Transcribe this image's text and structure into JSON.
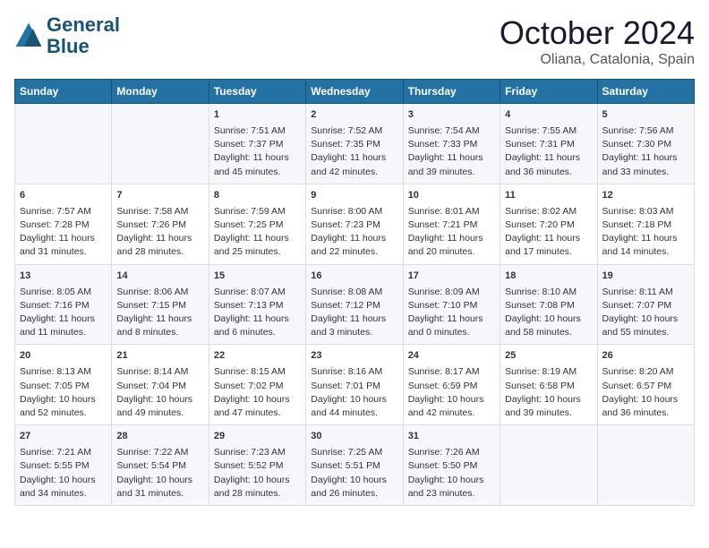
{
  "header": {
    "logo_line1": "General",
    "logo_line2": "Blue",
    "month": "October 2024",
    "location": "Oliana, Catalonia, Spain"
  },
  "columns": [
    "Sunday",
    "Monday",
    "Tuesday",
    "Wednesday",
    "Thursday",
    "Friday",
    "Saturday"
  ],
  "weeks": [
    [
      {
        "day": "",
        "lines": []
      },
      {
        "day": "",
        "lines": []
      },
      {
        "day": "1",
        "lines": [
          "Sunrise: 7:51 AM",
          "Sunset: 7:37 PM",
          "Daylight: 11 hours",
          "and 45 minutes."
        ]
      },
      {
        "day": "2",
        "lines": [
          "Sunrise: 7:52 AM",
          "Sunset: 7:35 PM",
          "Daylight: 11 hours",
          "and 42 minutes."
        ]
      },
      {
        "day": "3",
        "lines": [
          "Sunrise: 7:54 AM",
          "Sunset: 7:33 PM",
          "Daylight: 11 hours",
          "and 39 minutes."
        ]
      },
      {
        "day": "4",
        "lines": [
          "Sunrise: 7:55 AM",
          "Sunset: 7:31 PM",
          "Daylight: 11 hours",
          "and 36 minutes."
        ]
      },
      {
        "day": "5",
        "lines": [
          "Sunrise: 7:56 AM",
          "Sunset: 7:30 PM",
          "Daylight: 11 hours",
          "and 33 minutes."
        ]
      }
    ],
    [
      {
        "day": "6",
        "lines": [
          "Sunrise: 7:57 AM",
          "Sunset: 7:28 PM",
          "Daylight: 11 hours",
          "and 31 minutes."
        ]
      },
      {
        "day": "7",
        "lines": [
          "Sunrise: 7:58 AM",
          "Sunset: 7:26 PM",
          "Daylight: 11 hours",
          "and 28 minutes."
        ]
      },
      {
        "day": "8",
        "lines": [
          "Sunrise: 7:59 AM",
          "Sunset: 7:25 PM",
          "Daylight: 11 hours",
          "and 25 minutes."
        ]
      },
      {
        "day": "9",
        "lines": [
          "Sunrise: 8:00 AM",
          "Sunset: 7:23 PM",
          "Daylight: 11 hours",
          "and 22 minutes."
        ]
      },
      {
        "day": "10",
        "lines": [
          "Sunrise: 8:01 AM",
          "Sunset: 7:21 PM",
          "Daylight: 11 hours",
          "and 20 minutes."
        ]
      },
      {
        "day": "11",
        "lines": [
          "Sunrise: 8:02 AM",
          "Sunset: 7:20 PM",
          "Daylight: 11 hours",
          "and 17 minutes."
        ]
      },
      {
        "day": "12",
        "lines": [
          "Sunrise: 8:03 AM",
          "Sunset: 7:18 PM",
          "Daylight: 11 hours",
          "and 14 minutes."
        ]
      }
    ],
    [
      {
        "day": "13",
        "lines": [
          "Sunrise: 8:05 AM",
          "Sunset: 7:16 PM",
          "Daylight: 11 hours",
          "and 11 minutes."
        ]
      },
      {
        "day": "14",
        "lines": [
          "Sunrise: 8:06 AM",
          "Sunset: 7:15 PM",
          "Daylight: 11 hours",
          "and 8 minutes."
        ]
      },
      {
        "day": "15",
        "lines": [
          "Sunrise: 8:07 AM",
          "Sunset: 7:13 PM",
          "Daylight: 11 hours",
          "and 6 minutes."
        ]
      },
      {
        "day": "16",
        "lines": [
          "Sunrise: 8:08 AM",
          "Sunset: 7:12 PM",
          "Daylight: 11 hours",
          "and 3 minutes."
        ]
      },
      {
        "day": "17",
        "lines": [
          "Sunrise: 8:09 AM",
          "Sunset: 7:10 PM",
          "Daylight: 11 hours",
          "and 0 minutes."
        ]
      },
      {
        "day": "18",
        "lines": [
          "Sunrise: 8:10 AM",
          "Sunset: 7:08 PM",
          "Daylight: 10 hours",
          "and 58 minutes."
        ]
      },
      {
        "day": "19",
        "lines": [
          "Sunrise: 8:11 AM",
          "Sunset: 7:07 PM",
          "Daylight: 10 hours",
          "and 55 minutes."
        ]
      }
    ],
    [
      {
        "day": "20",
        "lines": [
          "Sunrise: 8:13 AM",
          "Sunset: 7:05 PM",
          "Daylight: 10 hours",
          "and 52 minutes."
        ]
      },
      {
        "day": "21",
        "lines": [
          "Sunrise: 8:14 AM",
          "Sunset: 7:04 PM",
          "Daylight: 10 hours",
          "and 49 minutes."
        ]
      },
      {
        "day": "22",
        "lines": [
          "Sunrise: 8:15 AM",
          "Sunset: 7:02 PM",
          "Daylight: 10 hours",
          "and 47 minutes."
        ]
      },
      {
        "day": "23",
        "lines": [
          "Sunrise: 8:16 AM",
          "Sunset: 7:01 PM",
          "Daylight: 10 hours",
          "and 44 minutes."
        ]
      },
      {
        "day": "24",
        "lines": [
          "Sunrise: 8:17 AM",
          "Sunset: 6:59 PM",
          "Daylight: 10 hours",
          "and 42 minutes."
        ]
      },
      {
        "day": "25",
        "lines": [
          "Sunrise: 8:19 AM",
          "Sunset: 6:58 PM",
          "Daylight: 10 hours",
          "and 39 minutes."
        ]
      },
      {
        "day": "26",
        "lines": [
          "Sunrise: 8:20 AM",
          "Sunset: 6:57 PM",
          "Daylight: 10 hours",
          "and 36 minutes."
        ]
      }
    ],
    [
      {
        "day": "27",
        "lines": [
          "Sunrise: 7:21 AM",
          "Sunset: 5:55 PM",
          "Daylight: 10 hours",
          "and 34 minutes."
        ]
      },
      {
        "day": "28",
        "lines": [
          "Sunrise: 7:22 AM",
          "Sunset: 5:54 PM",
          "Daylight: 10 hours",
          "and 31 minutes."
        ]
      },
      {
        "day": "29",
        "lines": [
          "Sunrise: 7:23 AM",
          "Sunset: 5:52 PM",
          "Daylight: 10 hours",
          "and 28 minutes."
        ]
      },
      {
        "day": "30",
        "lines": [
          "Sunrise: 7:25 AM",
          "Sunset: 5:51 PM",
          "Daylight: 10 hours",
          "and 26 minutes."
        ]
      },
      {
        "day": "31",
        "lines": [
          "Sunrise: 7:26 AM",
          "Sunset: 5:50 PM",
          "Daylight: 10 hours",
          "and 23 minutes."
        ]
      },
      {
        "day": "",
        "lines": []
      },
      {
        "day": "",
        "lines": []
      }
    ]
  ]
}
